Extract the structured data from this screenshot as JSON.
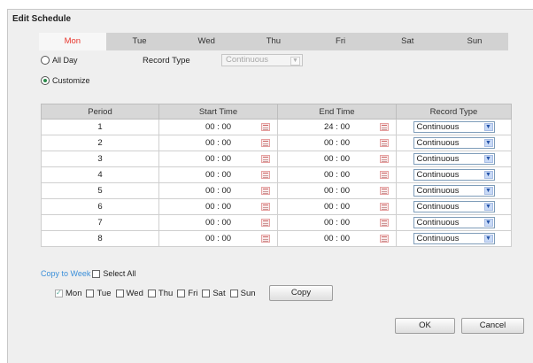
{
  "dialog": {
    "title": "Edit Schedule"
  },
  "day_tabs": [
    {
      "label": "Mon",
      "active": true
    },
    {
      "label": "Tue",
      "active": false
    },
    {
      "label": "Wed",
      "active": false
    },
    {
      "label": "Thu",
      "active": false
    },
    {
      "label": "Fri",
      "active": false
    },
    {
      "label": "Sat",
      "active": false
    },
    {
      "label": "Sun",
      "active": false
    }
  ],
  "mode": {
    "all_day_label": "All Day",
    "all_day_selected": false,
    "record_type_label": "Record Type",
    "record_type_value": "Continuous",
    "customize_label": "Customize",
    "customize_selected": true
  },
  "table": {
    "headers": [
      "Period",
      "Start Time",
      "End Time",
      "Record Type"
    ],
    "rows": [
      {
        "period": "1",
        "start": "00 : 00",
        "end": "24 : 00",
        "type": "Continuous"
      },
      {
        "period": "2",
        "start": "00 : 00",
        "end": "00 : 00",
        "type": "Continuous"
      },
      {
        "period": "3",
        "start": "00 : 00",
        "end": "00 : 00",
        "type": "Continuous"
      },
      {
        "period": "4",
        "start": "00 : 00",
        "end": "00 : 00",
        "type": "Continuous"
      },
      {
        "period": "5",
        "start": "00 : 00",
        "end": "00 : 00",
        "type": "Continuous"
      },
      {
        "period": "6",
        "start": "00 : 00",
        "end": "00 : 00",
        "type": "Continuous"
      },
      {
        "period": "7",
        "start": "00 : 00",
        "end": "00 : 00",
        "type": "Continuous"
      },
      {
        "period": "8",
        "start": "00 : 00",
        "end": "00 : 00",
        "type": "Continuous"
      }
    ]
  },
  "copy": {
    "copy_to_week_label": "Copy to Week",
    "select_all_label": "Select All",
    "days": [
      {
        "label": "Mon",
        "checked": true
      },
      {
        "label": "Tue",
        "checked": false
      },
      {
        "label": "Wed",
        "checked": false
      },
      {
        "label": "Thu",
        "checked": false
      },
      {
        "label": "Fri",
        "checked": false
      },
      {
        "label": "Sat",
        "checked": false
      },
      {
        "label": "Sun",
        "checked": false
      }
    ],
    "copy_button": "Copy"
  },
  "buttons": {
    "ok": "OK",
    "cancel": "Cancel"
  },
  "colors": {
    "active_tab_text": "#e8362d",
    "copy_link": "#3b8fd9",
    "tab_bg": "#d2d2d2",
    "header_bg": "#d7d7d7"
  }
}
